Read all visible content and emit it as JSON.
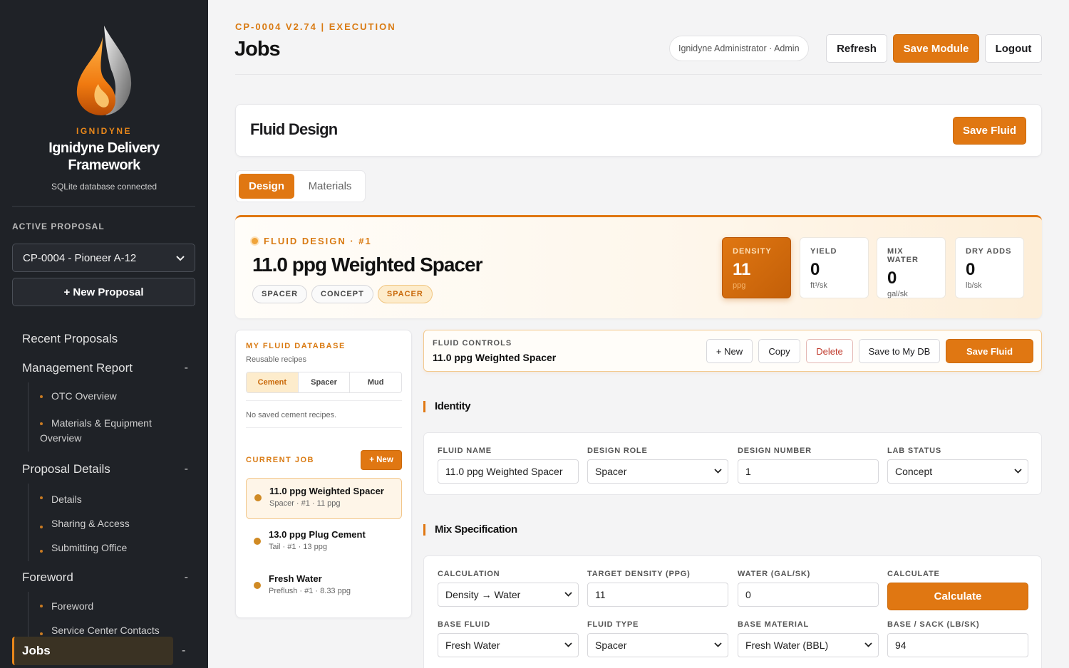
{
  "sidebar": {
    "brand_small": "IGNIDYNE",
    "brand_title": "Ignidyne Delivery Framework",
    "db_status": "SQLite database connected",
    "active_proposal_label": "ACTIVE PROPOSAL",
    "active_proposal_value": "CP-0004 - Pioneer A-12",
    "new_proposal": "+ New Proposal",
    "nav": {
      "recent": "Recent Proposals",
      "management": "Management Report",
      "management_items": [
        "OTC Overview",
        "Materials & Equipment",
        "Overview"
      ],
      "proposal_details": "Proposal Details",
      "proposal_items": [
        "Details",
        "Sharing & Access",
        "Submitting Office"
      ],
      "foreword": "Foreword",
      "foreword_items": [
        "Foreword",
        "Service Center Contacts"
      ],
      "jobs": "Jobs",
      "collapse": "-"
    }
  },
  "header": {
    "crumb": "CP-0004 V2.74 | EXECUTION",
    "title": "Jobs",
    "user": "Ignidyne Administrator · Admin",
    "refresh": "Refresh",
    "save_module": "Save Module",
    "logout": "Logout"
  },
  "fluid_design": {
    "title": "Fluid Design",
    "save": "Save Fluid",
    "tabs": [
      "Design",
      "Materials"
    ]
  },
  "hero": {
    "kicker": "FLUID DESIGN · #1",
    "title": "11.0 ppg Weighted Spacer",
    "pills": [
      "SPACER",
      "CONCEPT",
      "SPACER"
    ],
    "metrics": [
      {
        "label": "DENSITY",
        "value": "11",
        "unit": "ppg"
      },
      {
        "label": "YIELD",
        "value": "0",
        "unit": "ft³/sk"
      },
      {
        "label": "MIX WATER",
        "value": "0",
        "unit": "gal/sk"
      },
      {
        "label": "DRY ADDS",
        "value": "0",
        "unit": "lb/sk"
      }
    ]
  },
  "database": {
    "kicker": "MY FLUID DATABASE",
    "sub": "Reusable recipes",
    "segments": [
      "Cement",
      "Spacer",
      "Mud"
    ],
    "empty": "No saved cement recipes.",
    "current_job": "CURRENT JOB",
    "new": "+ New",
    "jobs": [
      {
        "title": "11.0 ppg Weighted Spacer",
        "sub": "Spacer · #1 · 11 ppg"
      },
      {
        "title": "13.0 ppg Plug Cement",
        "sub": "Tail · #1 · 13 ppg"
      },
      {
        "title": "Fresh Water",
        "sub": "Preflush · #1 · 8.33 ppg"
      }
    ]
  },
  "controls": {
    "kicker": "FLUID CONTROLS",
    "name": "11.0 ppg Weighted Spacer",
    "new": "+ New",
    "copy": "Copy",
    "delete": "Delete",
    "save_db": "Save to My DB",
    "save": "Save Fluid"
  },
  "identity": {
    "title": "Identity",
    "fluid_name_label": "FLUID NAME",
    "fluid_name": "11.0 ppg Weighted Spacer",
    "design_role_label": "DESIGN ROLE",
    "design_role": "Spacer",
    "design_number_label": "DESIGN NUMBER",
    "design_number": "1",
    "lab_status_label": "LAB STATUS",
    "lab_status": "Concept"
  },
  "mix": {
    "title": "Mix Specification",
    "calculation_label": "CALCULATION",
    "calculation": "Density → Water",
    "target_density_label": "TARGET DENSITY (PPG)",
    "target_density": "11",
    "water_label": "WATER (GAL/SK)",
    "water": "0",
    "calculate_label": "CALCULATE",
    "calculate": "Calculate",
    "base_fluid_label": "BASE FLUID",
    "base_fluid": "Fresh Water",
    "fluid_type_label": "FLUID TYPE",
    "fluid_type": "Spacer",
    "base_material_label": "BASE MATERIAL",
    "base_material": "Fresh Water (BBL)",
    "base_sack_label": "BASE / SACK (LB/SK)",
    "base_sack": "94"
  },
  "colors": {
    "accent": "#e07712",
    "sidebar": "#1f2227"
  }
}
